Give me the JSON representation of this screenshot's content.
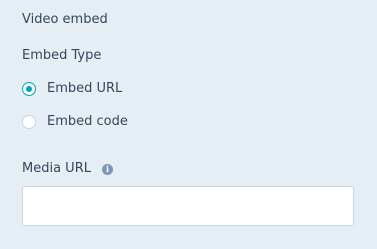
{
  "section": {
    "title": "Video embed"
  },
  "embed_type": {
    "label": "Embed Type",
    "options": [
      {
        "label": "Embed URL",
        "selected": true
      },
      {
        "label": "Embed code",
        "selected": false
      }
    ]
  },
  "media_url": {
    "label": "Media URL",
    "info_icon": "info-icon",
    "value": "",
    "placeholder": ""
  },
  "colors": {
    "background": "#e5edf5",
    "text": "#33475b",
    "accent": "#00a4bd",
    "input_border": "#cbd6e2",
    "info_icon": "#7c98b6"
  }
}
